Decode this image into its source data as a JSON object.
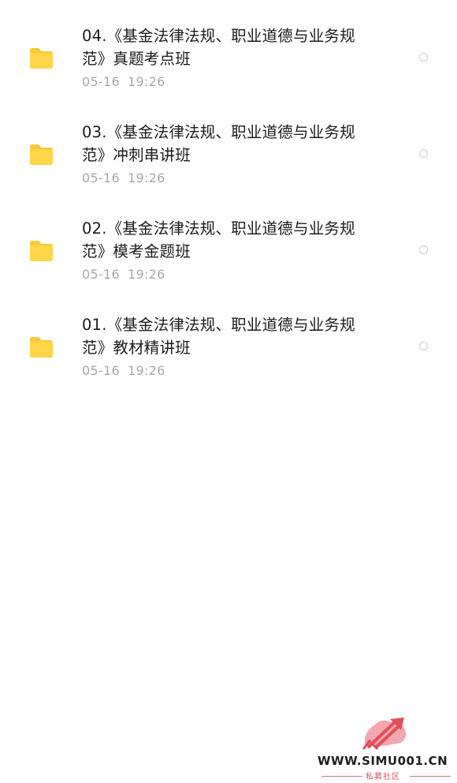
{
  "files": [
    {
      "name": "04.《基金法律法规、职业道德与业务规范》真题考点班",
      "date": "05-16",
      "time": "19:26",
      "icon": "folder-icon"
    },
    {
      "name": "03.《基金法律法规、职业道德与业务规范》冲刺串讲班",
      "date": "05-16",
      "time": "19:26",
      "icon": "folder-icon"
    },
    {
      "name": "02.《基金法律法规、职业道德与业务规范》模考金题班",
      "date": "05-16",
      "time": "19:26",
      "icon": "folder-icon"
    },
    {
      "name": "01.《基金法律法规、职业道德与业务规范》教材精讲班",
      "date": "05-16",
      "time": "19:26",
      "icon": "folder-icon"
    }
  ],
  "colors": {
    "folder": "#ffd54a",
    "folder_tab": "#f7c93a",
    "meta_text": "#a3a9b0",
    "radio_border": "#c9ccd1",
    "watermark_red": "#e0505c"
  },
  "watermark": {
    "url": "WWW.SIMU001.CN",
    "subtitle": "私募社区"
  }
}
